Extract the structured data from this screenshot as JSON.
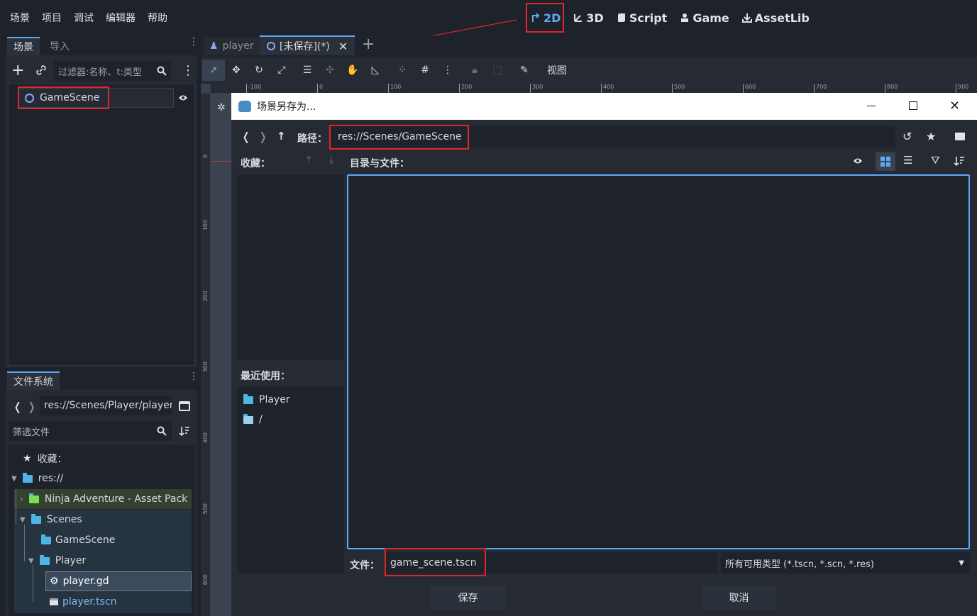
{
  "menubar": [
    "场景",
    "项目",
    "调试",
    "编辑器",
    "帮助"
  ],
  "workspaces": [
    {
      "label": "2D",
      "icon": "2d-icon"
    },
    {
      "label": "3D",
      "icon": "3d-icon"
    },
    {
      "label": "Script",
      "icon": "script-icon"
    },
    {
      "label": "Game",
      "icon": "game-icon"
    },
    {
      "label": "AssetLib",
      "icon": "assetlib-icon"
    }
  ],
  "scene_dock": {
    "tabs": [
      "场景",
      "导入"
    ],
    "filter_placeholder": "过滤器:名称、t:类型",
    "root_node": "GameScene"
  },
  "fs_dock": {
    "title": "文件系统",
    "path": "res://Scenes/Player/player.",
    "filter_placeholder": "筛选文件",
    "favorites_label": "收藏：",
    "tree": [
      "res://",
      "Ninja Adventure - Asset Pack",
      "Scenes",
      "GameScene",
      "Player",
      "player.gd",
      "player.tscn"
    ]
  },
  "editor_tabs": [
    {
      "label": "player"
    },
    {
      "label": "[未保存](*)"
    }
  ],
  "toolbar": {
    "view_label": "视图"
  },
  "ruler_ticks": [
    "-100",
    "0",
    "100",
    "200",
    "300",
    "400",
    "500",
    "600",
    "700",
    "800",
    "900"
  ],
  "vruler_ticks": [
    "0",
    "100",
    "200",
    "300",
    "400",
    "500",
    "600"
  ],
  "dialog": {
    "title": "场景另存为...",
    "path_label": "路径：",
    "path_value": "res://Scenes/GameScene",
    "favorites_label": "收藏：",
    "dirs_label": "目录与文件：",
    "recent_label": "最近使用：",
    "recent_items": [
      "Player",
      "/"
    ],
    "file_label": "文件：",
    "file_value": "game_scene.tscn",
    "filter_value": "所有可用类型 (*.tscn, *.scn, *.res)",
    "save_label": "保存",
    "cancel_label": "取消"
  },
  "colors": {
    "accent": "#5fa8f5",
    "highlight": "#e0262d",
    "folder": "#4fb5e6"
  }
}
